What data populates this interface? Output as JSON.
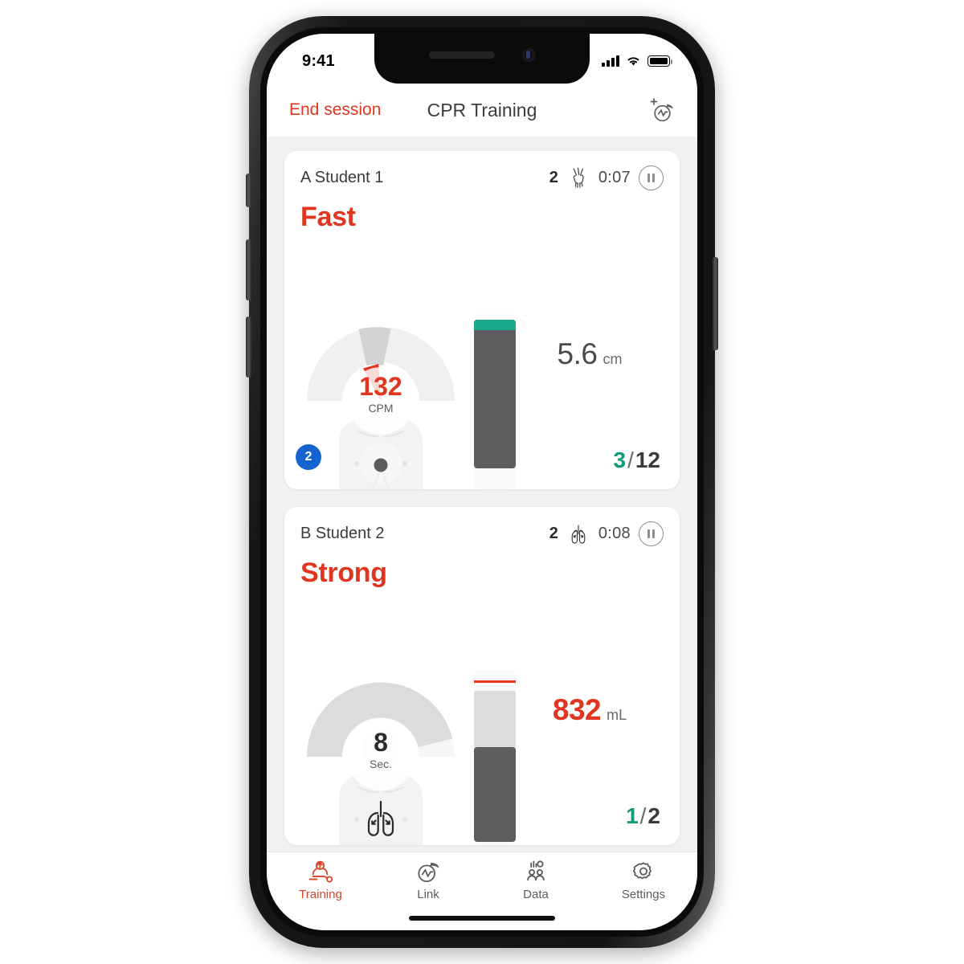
{
  "statusbar": {
    "time": "9:41",
    "signal_icon": "cellular-signal-icon",
    "wifi_icon": "wifi-icon",
    "battery_icon": "battery-icon"
  },
  "navbar": {
    "left_action": "End session",
    "title": "CPR Training",
    "right_icon": "add-session-icon"
  },
  "theme": {
    "accent_red": "#e0351f",
    "green": "#139a7c",
    "teal_bar": "#1aa98a",
    "badge_blue": "#1463cf",
    "bar_dark": "#5e5e60",
    "page_bg": "#f1f1f3"
  },
  "cards": [
    {
      "student": "A Student 1",
      "vent_count": "2",
      "activity_icon": "compression-hands-icon",
      "timer": "0:07",
      "pause_icon": "pause-icon",
      "feedback": "Fast",
      "gauge": {
        "value": "132",
        "unit": "CPM",
        "value_color": "red",
        "needle": true,
        "needle_angle_deg": 74,
        "target_zone_start_deg": -22,
        "target_zone_end_deg": 16
      },
      "bar": {
        "type": "depth",
        "fill_percent": 88,
        "cap_color": "#1aa98a",
        "fill_color": "#5e5e60"
      },
      "measure": {
        "value": "5.6",
        "unit": "cm",
        "style": "gray"
      },
      "ratio": {
        "done": "3",
        "sep": "/",
        "total": "12"
      },
      "badge": "2"
    },
    {
      "student": "B Student 2",
      "vent_count": "2",
      "activity_icon": "lungs-icon",
      "timer": "0:08",
      "pause_icon": "pause-icon",
      "feedback": "Strong",
      "gauge": {
        "value": "8",
        "unit": "Sec.",
        "value_color": "dark",
        "needle": false,
        "arc_fill_percent": 84
      },
      "bar": {
        "type": "volume",
        "fill_percent": 56,
        "limit_line_percent": 92,
        "limit_color": "#e0351f",
        "zone_color": "#dcdcde",
        "fill_color": "#5e5e60"
      },
      "measure": {
        "value": "832",
        "unit": "mL",
        "style": "red"
      },
      "ratio": {
        "done": "1",
        "sep": "/",
        "total": "2"
      },
      "badge": null
    }
  ],
  "tabbar": {
    "items": [
      {
        "label": "Training",
        "icon": "cpr-training-icon",
        "active": true
      },
      {
        "label": "Link",
        "icon": "link-stopwatch-icon",
        "active": false
      },
      {
        "label": "Data",
        "icon": "data-people-icon",
        "active": false
      },
      {
        "label": "Settings",
        "icon": "gear-icon",
        "active": false
      }
    ]
  }
}
